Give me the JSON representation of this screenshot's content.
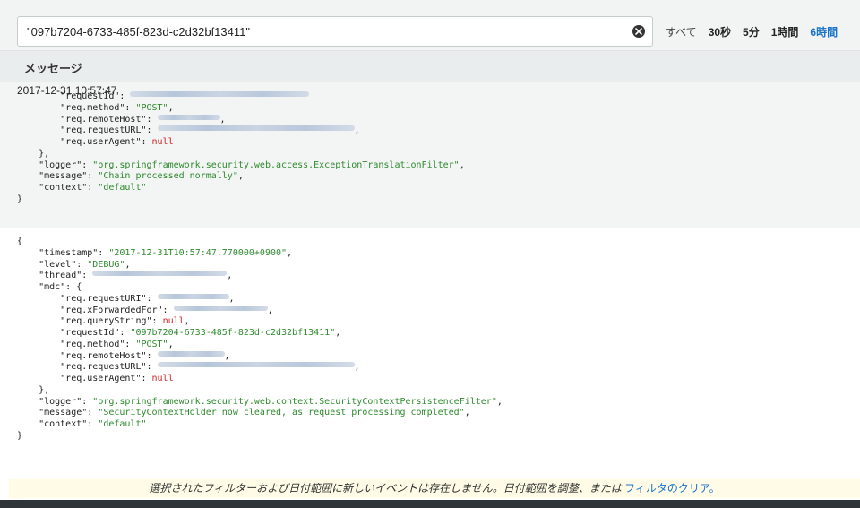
{
  "search": {
    "value": "\"097b7204-6733-485f-823d-c2d32bf13411\""
  },
  "time_ranges": [
    {
      "label": "すべて",
      "state": "normal"
    },
    {
      "label": "30秒",
      "state": "bold"
    },
    {
      "label": "5分",
      "state": "bold"
    },
    {
      "label": "1時間",
      "state": "bold"
    },
    {
      "label": "6時間",
      "state": "active"
    }
  ],
  "messages_header": "メッセージ",
  "event1": {
    "timestamp": "2017-12-31 10:57:47",
    "lines": [
      [
        {
          "t": "k",
          "v": "        \"requestId\": "
        },
        {
          "t": "b",
          "w": 200
        }
      ],
      [
        {
          "t": "k",
          "v": "        \"req.method\": "
        },
        {
          "t": "s",
          "v": "\"POST\""
        },
        {
          "t": "k",
          "v": ","
        }
      ],
      [
        {
          "t": "k",
          "v": "        \"req.remoteHost\": "
        },
        {
          "t": "b",
          "w": 70
        },
        {
          "t": "k",
          "v": ","
        }
      ],
      [
        {
          "t": "k",
          "v": "        \"req.requestURL\": "
        },
        {
          "t": "b",
          "w": 220
        },
        {
          "t": "k",
          "v": ","
        }
      ],
      [
        {
          "t": "k",
          "v": "        \"req.userAgent\": "
        },
        {
          "t": "n",
          "v": "null"
        }
      ],
      [
        {
          "t": "k",
          "v": "    },"
        }
      ],
      [
        {
          "t": "k",
          "v": "    \"logger\": "
        },
        {
          "t": "s",
          "v": "\"org.springframework.security.web.access.ExceptionTranslationFilter\""
        },
        {
          "t": "k",
          "v": ","
        }
      ],
      [
        {
          "t": "k",
          "v": "    \"message\": "
        },
        {
          "t": "s",
          "v": "\"Chain processed normally\""
        },
        {
          "t": "k",
          "v": ","
        }
      ],
      [
        {
          "t": "k",
          "v": "    \"context\": "
        },
        {
          "t": "s",
          "v": "\"default\""
        }
      ],
      [
        {
          "t": "k",
          "v": "}"
        }
      ]
    ]
  },
  "event2": {
    "lines": [
      [
        {
          "t": "k",
          "v": "{"
        }
      ],
      [
        {
          "t": "k",
          "v": "    \"timestamp\": "
        },
        {
          "t": "s",
          "v": "\"2017-12-31T10:57:47.770000+0900\""
        },
        {
          "t": "k",
          "v": ","
        }
      ],
      [
        {
          "t": "k",
          "v": "    \"level\": "
        },
        {
          "t": "s",
          "v": "\"DEBUG\""
        },
        {
          "t": "k",
          "v": ","
        }
      ],
      [
        {
          "t": "k",
          "v": "    \"thread\": "
        },
        {
          "t": "b",
          "w": 150
        },
        {
          "t": "k",
          "v": ","
        }
      ],
      [
        {
          "t": "k",
          "v": "    \"mdc\": {"
        }
      ],
      [
        {
          "t": "k",
          "v": "        \"req.requestURI\": "
        },
        {
          "t": "b",
          "w": 80
        },
        {
          "t": "k",
          "v": ","
        }
      ],
      [
        {
          "t": "k",
          "v": "        \"req.xForwardedFor\": "
        },
        {
          "t": "b",
          "w": 105
        },
        {
          "t": "k",
          "v": ","
        }
      ],
      [
        {
          "t": "k",
          "v": "        \"req.queryString\": "
        },
        {
          "t": "n",
          "v": "null"
        },
        {
          "t": "k",
          "v": ","
        }
      ],
      [
        {
          "t": "k",
          "v": "        \"requestId\": "
        },
        {
          "t": "s",
          "v": "\"097b7204-6733-485f-823d-c2d32bf13411\""
        },
        {
          "t": "k",
          "v": ","
        }
      ],
      [
        {
          "t": "k",
          "v": "        \"req.method\": "
        },
        {
          "t": "s",
          "v": "\"POST\""
        },
        {
          "t": "k",
          "v": ","
        }
      ],
      [
        {
          "t": "k",
          "v": "        \"req.remoteHost\": "
        },
        {
          "t": "b",
          "w": 75
        },
        {
          "t": "k",
          "v": ","
        }
      ],
      [
        {
          "t": "k",
          "v": "        \"req.requestURL\": "
        },
        {
          "t": "b",
          "w": 220
        },
        {
          "t": "k",
          "v": ","
        }
      ],
      [
        {
          "t": "k",
          "v": "        \"req.userAgent\": "
        },
        {
          "t": "n",
          "v": "null"
        }
      ],
      [
        {
          "t": "k",
          "v": "    },"
        }
      ],
      [
        {
          "t": "k",
          "v": "    \"logger\": "
        },
        {
          "t": "s",
          "v": "\"org.springframework.security.web.context.SecurityContextPersistenceFilter\""
        },
        {
          "t": "k",
          "v": ","
        }
      ],
      [
        {
          "t": "k",
          "v": "    \"message\": "
        },
        {
          "t": "s",
          "v": "\"SecurityContextHolder now cleared, as request processing completed\""
        },
        {
          "t": "k",
          "v": ","
        }
      ],
      [
        {
          "t": "k",
          "v": "    \"context\": "
        },
        {
          "t": "s",
          "v": "\"default\""
        }
      ],
      [
        {
          "t": "k",
          "v": "}"
        }
      ]
    ]
  },
  "notice": {
    "text": "選択されたフィルターおよび日付範囲に新しいイベントは存在しません。日付範囲を調整、または",
    "link": "フィルタのクリア。"
  },
  "colors": {
    "accent": "#1a73c8",
    "string": "#2e8b2e",
    "null": "#d02424"
  }
}
